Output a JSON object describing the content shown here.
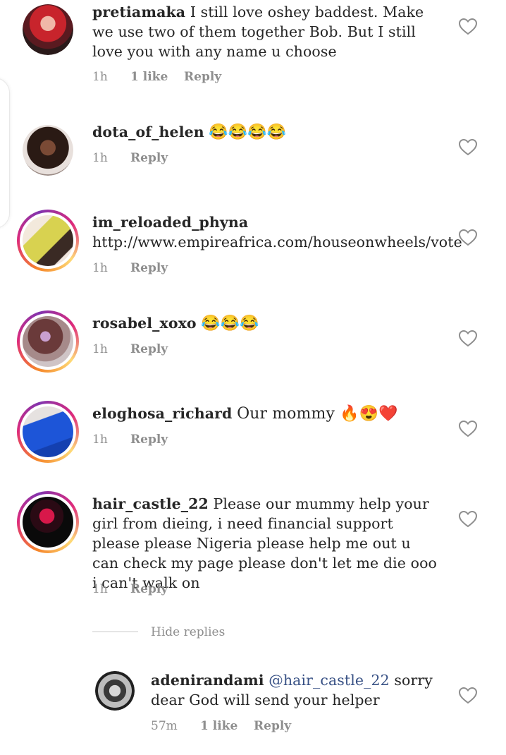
{
  "comments": [
    {
      "username": "pretiamaka",
      "text": "I still love oshey baddest. Make we use two of them together Bob. But I  still love you with any name u choose",
      "time": "1h",
      "likes": "1 like",
      "reply": "Reply"
    },
    {
      "username": "dota_of_helen",
      "text": "😂😂😂😂",
      "time": "1h",
      "reply": "Reply"
    },
    {
      "username": "im_reloaded_phyna",
      "text": "http://www.empireafrica.com/houseonwheels/vote",
      "time": "1h",
      "reply": "Reply"
    },
    {
      "username": "rosabel_xoxo",
      "text": "😂😂😂",
      "time": "1h",
      "reply": "Reply"
    },
    {
      "username": "eloghosa_richard",
      "text": "Our mommy 🔥😍❤️",
      "time": "1h",
      "reply": "Reply"
    },
    {
      "username": "hair_castle_22",
      "text": "Please our mummy help your girl from dieing, i need financial support please please Nigeria please help me out u can check my page please don't let me die ooo i can't walk on",
      "time": "1h",
      "reply": "Reply"
    }
  ],
  "hide_replies": "Hide replies",
  "reply_comment": {
    "username": "adenirandami",
    "mention": "@hair_castle_22",
    "text": "sorry dear God will send your helper",
    "time": "57m",
    "likes": "1 like",
    "reply": "Reply"
  },
  "colors": {
    "text": "#262626",
    "meta": "#8e8e8e",
    "mention": "#385185",
    "ring_start": "#f58529",
    "ring_mid": "#dd2a7b",
    "ring_end": "#8134af"
  },
  "icons": [
    "heart-outline-icon"
  ]
}
